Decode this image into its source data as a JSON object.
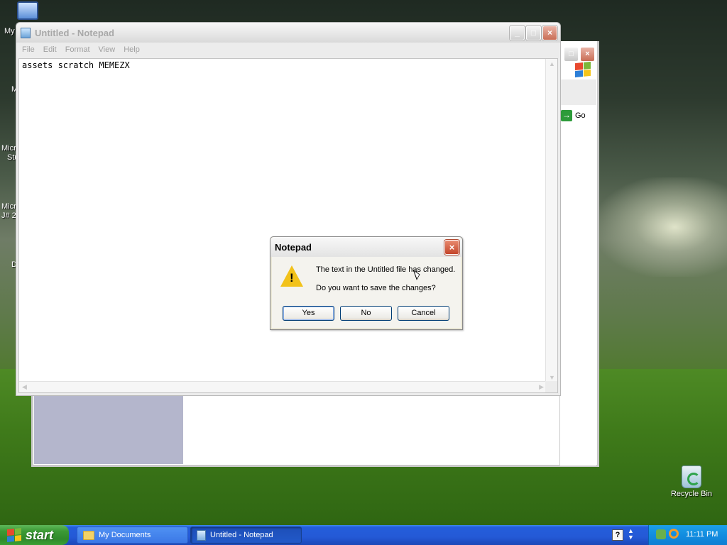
{
  "desktop": {
    "icons": {
      "my_computer": "My",
      "frag1": "M",
      "frag2_line1": "Micro",
      "frag2_line2": "Stu",
      "frag3_line1": "Micro",
      "frag3_line2": "J# 2",
      "frag4": "D",
      "recycle_bin": "Recycle Bin"
    }
  },
  "back_window": {
    "go_label": "Go"
  },
  "notepad": {
    "title": "Untitled - Notepad",
    "menu": [
      "File",
      "Edit",
      "Format",
      "View",
      "Help"
    ],
    "content": "assets scratch MEMEZX"
  },
  "dialog": {
    "title": "Notepad",
    "message_line1": "The text in the Untitled file has changed.",
    "message_line2": "Do you want to save the changes?",
    "buttons": {
      "yes": "Yes",
      "no": "No",
      "cancel": "Cancel"
    },
    "icon": "warning-icon"
  },
  "taskbar": {
    "start_label": "start",
    "tasks": [
      {
        "label": "My Documents",
        "icon": "folder-icon"
      },
      {
        "label": "Untitled - Notepad",
        "icon": "notepad-icon"
      }
    ],
    "clock": "11:11 PM"
  },
  "colors": {
    "taskbar_blue": "#245edb",
    "start_green": "#3c9a35",
    "tray_blue": "#128de0"
  }
}
